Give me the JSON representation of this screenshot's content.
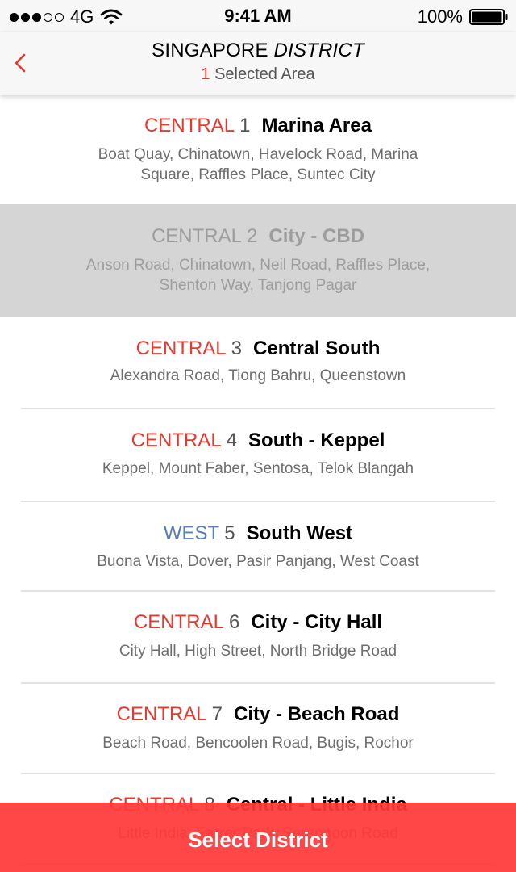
{
  "status_bar": {
    "signal_filled": 3,
    "signal_total": 5,
    "network": "4G",
    "time": "9:41 AM",
    "battery_percent": "100%",
    "icons": [
      "signal-dots-icon",
      "wifi-icon",
      "battery-icon"
    ]
  },
  "nav": {
    "title_main": "SINGAPORE",
    "title_italic": "DISTRICT",
    "selected_count": "1",
    "selected_label": "Selected Area",
    "back_icon": "chevron-left-icon"
  },
  "colors": {
    "accent": "#e8392f",
    "west": "#5a7fb5",
    "button": "#ff3939",
    "selected_row": "#d5d5d5"
  },
  "districts": [
    {
      "region": "CENTRAL",
      "number": "1",
      "name": "Marina Area",
      "areas": "Boat Quay, Chinatown, Havelock Road, Marina Square, Raffles Place, Suntec City",
      "selected": false
    },
    {
      "region": "CENTRAL",
      "number": "2",
      "name": "City - CBD",
      "areas": "Anson Road, Chinatown, Neil Road, Raffles Place, Shenton Way, Tanjong Pagar",
      "selected": true
    },
    {
      "region": "CENTRAL",
      "number": "3",
      "name": "Central South",
      "areas": "Alexandra Road, Tiong Bahru, Queenstown",
      "selected": false
    },
    {
      "region": "CENTRAL",
      "number": "4",
      "name": "South - Keppel",
      "areas": "Keppel, Mount Faber, Sentosa, Telok Blangah",
      "selected": false
    },
    {
      "region": "WEST",
      "number": "5",
      "name": "South West",
      "areas": "Buona Vista, Dover, Pasir Panjang, West Coast",
      "selected": false
    },
    {
      "region": "CENTRAL",
      "number": "6",
      "name": "City - City Hall",
      "areas": "City Hall, High Street, North Bridge Road",
      "selected": false
    },
    {
      "region": "CENTRAL",
      "number": "7",
      "name": "City - Beach Road",
      "areas": "Beach Road, Bencoolen Road, Bugis, Rochor",
      "selected": false
    },
    {
      "region": "CENTRAL",
      "number": "8",
      "name": "Central - Little India",
      "areas": "Little India, Farrer Park, Serangoon Road",
      "selected": false
    }
  ],
  "select_button": {
    "label": "Select District"
  }
}
